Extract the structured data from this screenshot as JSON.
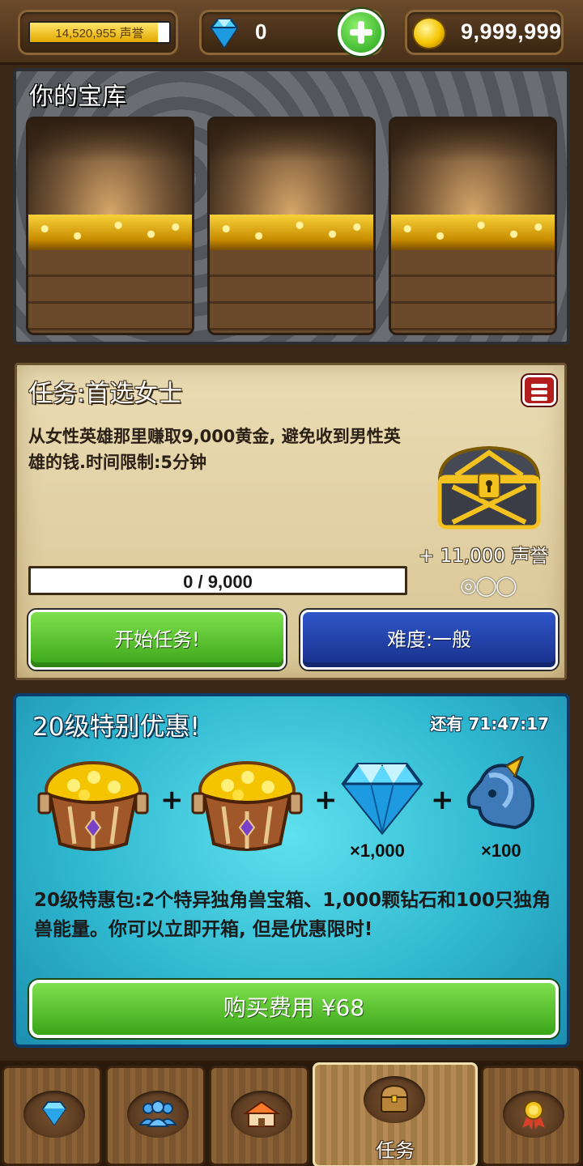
{
  "topbar": {
    "reputation_label": "14,520,955 声誉",
    "reputation_progress": 0.92,
    "gems": "0",
    "gold": "9,999,999"
  },
  "vault": {
    "title": "你的宝库",
    "slot_count": 3
  },
  "quest": {
    "title": "任务:首选女士",
    "description": "从女性英雄那里赚取9,000黄金, 避免收到男性英雄的钱.时间限制:5分钟",
    "reward": "+ 11,000 声誉",
    "stars": "◎◯◯",
    "progress_text": "0 / 9,000",
    "progress_value": 0,
    "start_button": "开始任务!",
    "difficulty_button": "难度:一般"
  },
  "offer": {
    "title": "20级特别优惠!",
    "timer": "还有 71:47:17",
    "bundle": {
      "chest_icon": "treasure-chest-icon",
      "diamond_qty": "×1,000",
      "unicorn_qty": "×100",
      "plus": "+"
    },
    "description": "20级特惠包:2个特异独角兽宝箱、1,000颗钻石和100只独角兽能量。你可以立即开箱, 但是优惠限时!",
    "buy_button": "购买费用 ¥68"
  },
  "nav": {
    "tabs": [
      {
        "icon": "diamond-icon",
        "label": ""
      },
      {
        "icon": "heroes-icon",
        "label": ""
      },
      {
        "icon": "buildings-icon",
        "label": ""
      },
      {
        "icon": "chest-icon",
        "label": "任务",
        "active": true
      },
      {
        "icon": "medal-icon",
        "label": ""
      }
    ]
  },
  "colors": {
    "accent_green": "#3aa518",
    "accent_blue": "#18308a",
    "offer_cyan": "#2fb8d0",
    "parchment": "#e2d2a6"
  }
}
